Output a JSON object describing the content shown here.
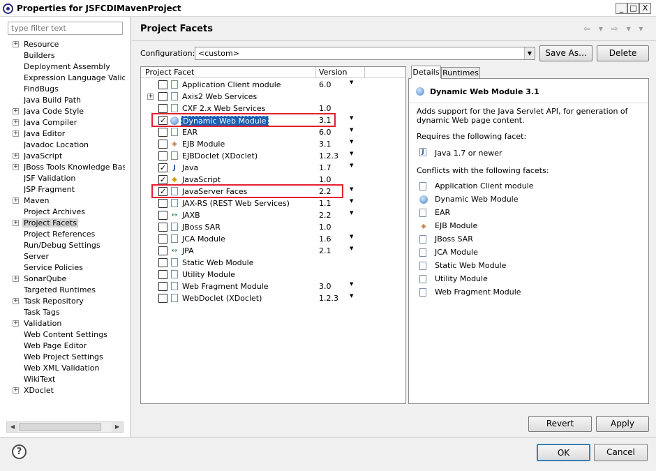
{
  "window": {
    "title": "Properties for JSFCDIMavenProject",
    "minimize": "_",
    "maximize": "□",
    "close": "X"
  },
  "filter": {
    "placeholder": "type filter text"
  },
  "nav": {
    "items": [
      {
        "label": "Resource",
        "expandable": true
      },
      {
        "label": "Builders",
        "expandable": false
      },
      {
        "label": "Deployment Assembly",
        "expandable": false
      },
      {
        "label": "Expression Language Validatic",
        "expandable": false
      },
      {
        "label": "FindBugs",
        "expandable": false
      },
      {
        "label": "Java Build Path",
        "expandable": false
      },
      {
        "label": "Java Code Style",
        "expandable": true
      },
      {
        "label": "Java Compiler",
        "expandable": true
      },
      {
        "label": "Java Editor",
        "expandable": true
      },
      {
        "label": "Javadoc Location",
        "expandable": false
      },
      {
        "label": "JavaScript",
        "expandable": true
      },
      {
        "label": "JBoss Tools Knowledge Base",
        "expandable": true
      },
      {
        "label": "JSF Validation",
        "expandable": false
      },
      {
        "label": "JSP Fragment",
        "expandable": false
      },
      {
        "label": "Maven",
        "expandable": true
      },
      {
        "label": "Project Archives",
        "expandable": false
      },
      {
        "label": "Project Facets",
        "expandable": true,
        "selected": true
      },
      {
        "label": "Project References",
        "expandable": false
      },
      {
        "label": "Run/Debug Settings",
        "expandable": false
      },
      {
        "label": "Server",
        "expandable": false
      },
      {
        "label": "Service Policies",
        "expandable": false
      },
      {
        "label": "SonarQube",
        "expandable": true
      },
      {
        "label": "Targeted Runtimes",
        "expandable": false
      },
      {
        "label": "Task Repository",
        "expandable": true
      },
      {
        "label": "Task Tags",
        "expandable": false
      },
      {
        "label": "Validation",
        "expandable": true
      },
      {
        "label": "Web Content Settings",
        "expandable": false
      },
      {
        "label": "Web Page Editor",
        "expandable": false
      },
      {
        "label": "Web Project Settings",
        "expandable": false
      },
      {
        "label": "Web XML Validation",
        "expandable": false
      },
      {
        "label": "WikiText",
        "expandable": false
      },
      {
        "label": "XDoclet",
        "expandable": true
      }
    ]
  },
  "page": {
    "title": "Project Facets",
    "nav_arrows": "⇦ ▾ ⇨ ▾ ▾"
  },
  "configuration": {
    "label": "Configuration:",
    "value": "<custom>",
    "save_as": "Save As...",
    "delete": "Delete"
  },
  "facets": {
    "col_facet": "Project Facet",
    "col_version": "Version",
    "rows": [
      {
        "name": "Application Client module",
        "version": "6.0",
        "checked": false,
        "expandable": false,
        "icon": "page-icon",
        "dropdown": true
      },
      {
        "name": "Axis2 Web Services",
        "version": "",
        "checked": false,
        "expandable": true,
        "icon": "page-icon",
        "dropdown": false
      },
      {
        "name": "CXF 2.x Web Services",
        "version": "1.0",
        "checked": false,
        "expandable": false,
        "icon": "page-icon",
        "dropdown": false
      },
      {
        "name": "Dynamic Web Module",
        "version": "3.1",
        "checked": true,
        "expandable": false,
        "icon": "globe-icon",
        "dropdown": true,
        "selected": true
      },
      {
        "name": "EAR",
        "version": "6.0",
        "checked": false,
        "expandable": false,
        "icon": "page-icon",
        "dropdown": true
      },
      {
        "name": "EJB Module",
        "version": "3.1",
        "checked": false,
        "expandable": false,
        "icon": "ejb-icon",
        "dropdown": true
      },
      {
        "name": "EJBDoclet (XDoclet)",
        "version": "1.2.3",
        "checked": false,
        "expandable": false,
        "icon": "page-icon",
        "dropdown": true
      },
      {
        "name": "Java",
        "version": "1.7",
        "checked": true,
        "expandable": false,
        "icon": "java-icon",
        "dropdown": true
      },
      {
        "name": "JavaScript",
        "version": "1.0",
        "checked": true,
        "expandable": false,
        "icon": "javascript-icon",
        "dropdown": false
      },
      {
        "name": "JavaServer Faces",
        "version": "2.2",
        "checked": true,
        "expandable": false,
        "icon": "page-icon",
        "dropdown": true
      },
      {
        "name": "JAX-RS (REST Web Services)",
        "version": "1.1",
        "checked": false,
        "expandable": false,
        "icon": "page-icon",
        "dropdown": true
      },
      {
        "name": "JAXB",
        "version": "2.2",
        "checked": false,
        "expandable": false,
        "icon": "jaxb-icon",
        "dropdown": true
      },
      {
        "name": "JBoss SAR",
        "version": "1.0",
        "checked": false,
        "expandable": false,
        "icon": "page-icon",
        "dropdown": false
      },
      {
        "name": "JCA Module",
        "version": "1.6",
        "checked": false,
        "expandable": false,
        "icon": "page-icon",
        "dropdown": true
      },
      {
        "name": "JPA",
        "version": "2.1",
        "checked": false,
        "expandable": false,
        "icon": "jpa-icon",
        "dropdown": true
      },
      {
        "name": "Static Web Module",
        "version": "",
        "checked": false,
        "expandable": false,
        "icon": "page-icon",
        "dropdown": false
      },
      {
        "name": "Utility Module",
        "version": "",
        "checked": false,
        "expandable": false,
        "icon": "page-icon",
        "dropdown": false
      },
      {
        "name": "Web Fragment Module",
        "version": "3.0",
        "checked": false,
        "expandable": false,
        "icon": "page-icon",
        "dropdown": true
      },
      {
        "name": "WebDoclet (XDoclet)",
        "version": "1.2.3",
        "checked": false,
        "expandable": false,
        "icon": "page-icon",
        "dropdown": true
      }
    ]
  },
  "details": {
    "tab_details": "Details",
    "tab_runtimes": "Runtimes",
    "heading": "Dynamic Web Module 3.1",
    "description_line1": "Adds support for the Java Servlet API, for generation of",
    "description_line2": "dynamic Web page content.",
    "requires_label": "Requires the following facet:",
    "requires_item": "Java 1.7 or newer",
    "conflicts_label": "Conflicts with the following facets:",
    "conflicts": [
      {
        "label": "Application Client module",
        "icon": "page-icon"
      },
      {
        "label": "Dynamic Web Module",
        "icon": "globe-icon"
      },
      {
        "label": "EAR",
        "icon": "page-icon"
      },
      {
        "label": "EJB Module",
        "icon": "ejb-icon"
      },
      {
        "label": "JBoss SAR",
        "icon": "page-icon"
      },
      {
        "label": "JCA Module",
        "icon": "page-icon"
      },
      {
        "label": "Static Web Module",
        "icon": "page-icon"
      },
      {
        "label": "Utility Module",
        "icon": "page-icon"
      },
      {
        "label": "Web Fragment Module",
        "icon": "page-icon"
      }
    ]
  },
  "buttons": {
    "revert": "Revert",
    "apply": "Apply",
    "ok": "OK",
    "cancel": "Cancel",
    "help": "?"
  },
  "colors": {
    "highlight_box": "#e32030",
    "selection": "#1a5fb4"
  }
}
